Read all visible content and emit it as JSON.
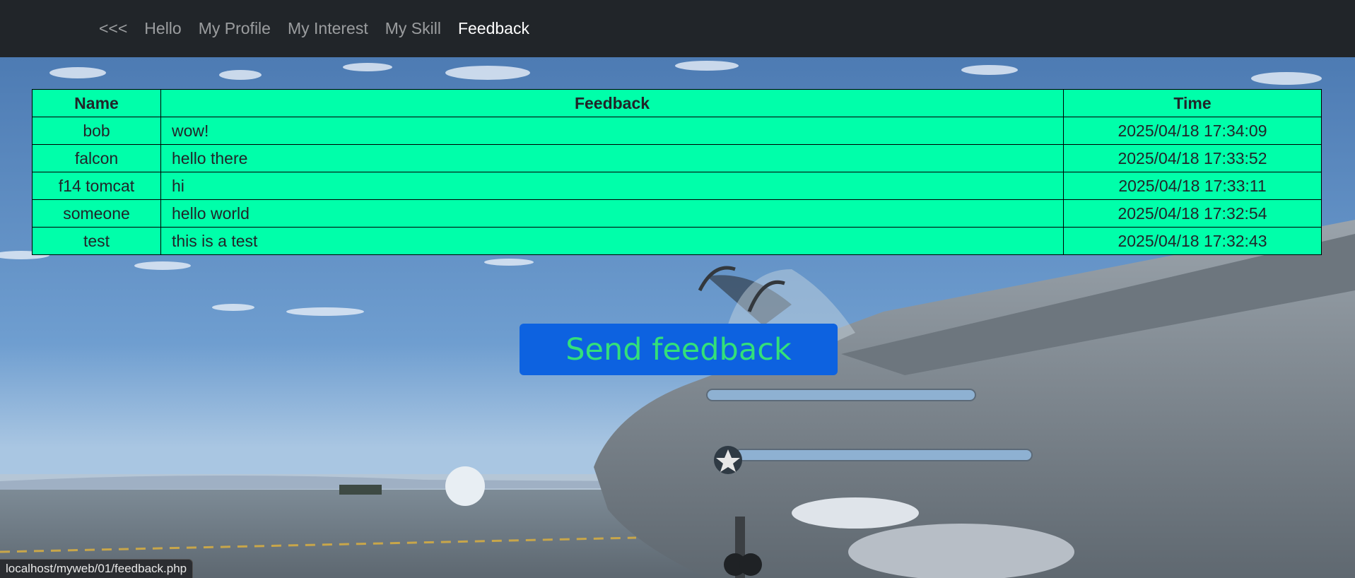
{
  "nav": {
    "items": [
      {
        "label": "<<<",
        "active": false
      },
      {
        "label": "Hello",
        "active": false
      },
      {
        "label": "My Profile",
        "active": false
      },
      {
        "label": "My Interest",
        "active": false
      },
      {
        "label": "My Skill",
        "active": false
      },
      {
        "label": "Feedback",
        "active": true
      }
    ]
  },
  "table": {
    "headers": {
      "name": "Name",
      "feedback": "Feedback",
      "time": "Time"
    },
    "rows": [
      {
        "name": "bob",
        "feedback": "wow!",
        "time": "2025/04/18 17:34:09"
      },
      {
        "name": "falcon",
        "feedback": "hello there",
        "time": "2025/04/18 17:33:52"
      },
      {
        "name": "f14 tomcat",
        "feedback": "hi",
        "time": "2025/04/18 17:33:11"
      },
      {
        "name": "someone",
        "feedback": "hello world",
        "time": "2025/04/18 17:32:54"
      },
      {
        "name": "test",
        "feedback": "this is a test",
        "time": "2025/04/18 17:32:43"
      }
    ]
  },
  "send_button": {
    "label": "Send feedback"
  },
  "status_bar": {
    "url": "localhost/myweb/01/feedback.php"
  },
  "colors": {
    "navbar": "#212529",
    "table_bg": "#00ffaa",
    "button_bg": "#0d62e0",
    "button_text": "#33e07a"
  }
}
